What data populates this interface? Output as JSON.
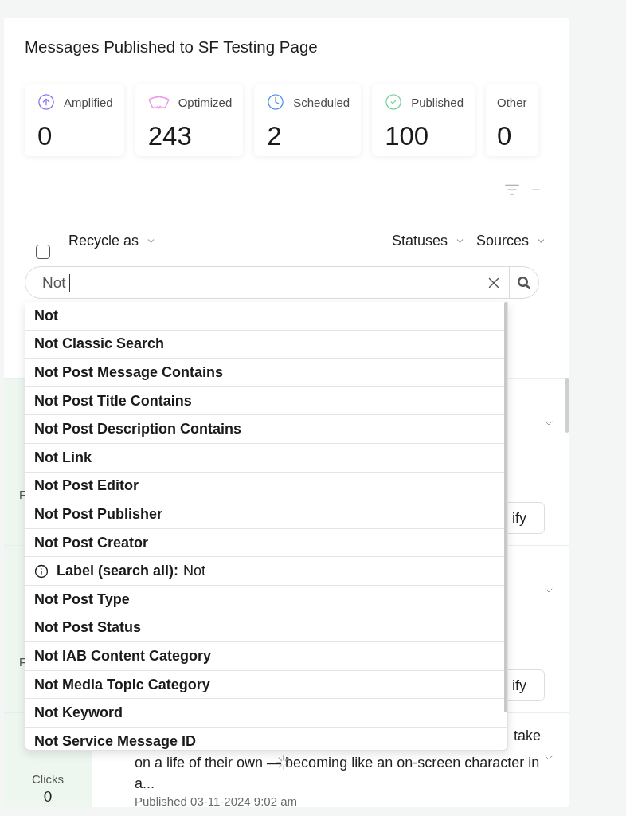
{
  "title": "Messages Published to SF Testing Page",
  "stats": [
    {
      "kind": "amplified",
      "label": "Amplified",
      "value": "0"
    },
    {
      "kind": "optimized",
      "label": "Optimized",
      "value": "243"
    },
    {
      "kind": "scheduled",
      "label": "Scheduled",
      "value": "2"
    },
    {
      "kind": "published",
      "label": "Published",
      "value": "100"
    },
    {
      "kind": "other",
      "label": "Other",
      "value": "0"
    }
  ],
  "toolbar": {
    "select_all": {
      "checked": false
    },
    "recycle_menu": "Recycle as",
    "filters": [
      "Statuses",
      "Sources"
    ]
  },
  "search": {
    "value": "Not",
    "focused": true
  },
  "suggestions": [
    {
      "kind": "option",
      "label": "Not"
    },
    {
      "kind": "option",
      "label": "Not Classic Search"
    },
    {
      "kind": "option",
      "label": "Not Post Message Contains"
    },
    {
      "kind": "option",
      "label": "Not Post Title Contains"
    },
    {
      "kind": "option",
      "label": "Not Post Description Contains"
    },
    {
      "kind": "option",
      "label": "Not Link"
    },
    {
      "kind": "option",
      "label": "Not Post Editor"
    },
    {
      "kind": "option",
      "label": "Not Post Publisher"
    },
    {
      "kind": "option",
      "label": "Not Post Creator"
    },
    {
      "kind": "label_search",
      "label": "Label (search all):",
      "query": "Not"
    },
    {
      "kind": "option",
      "label": "Not Post Type"
    },
    {
      "kind": "option",
      "label": "Not Post Status"
    },
    {
      "kind": "option",
      "label": "Not IAB Content Category"
    },
    {
      "kind": "option",
      "label": "Not Media Topic Category"
    },
    {
      "kind": "option",
      "label": "Not Keyword"
    },
    {
      "kind": "option",
      "label": "Not Service Message ID"
    }
  ],
  "messages": [
    {
      "stat_label": "F",
      "action": "ify"
    },
    {
      "stat_label": "F",
      "action": "ify"
    },
    {
      "stat_label": "Clicks",
      "stat_value": "0",
      "text_tail": "take",
      "text": "on a life of their own — becoming like an on-screen character in a...",
      "published": "Published 03-11-2024 9:02 am",
      "loading": true
    }
  ]
}
